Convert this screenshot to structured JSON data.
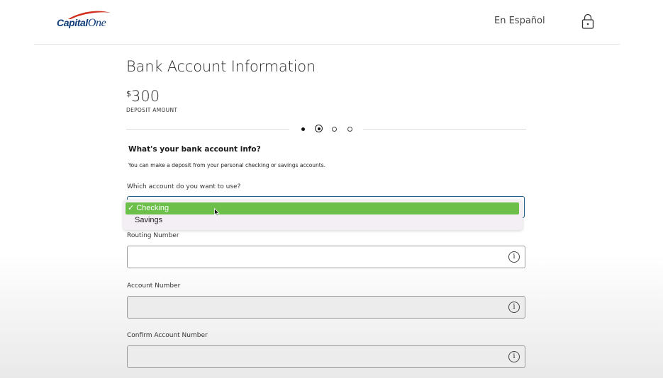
{
  "header": {
    "logo_text": "Capital",
    "logo_text_2": "One",
    "language_link": "En Español",
    "lock_icon": "lock-icon"
  },
  "page": {
    "title": "Bank Account Information",
    "deposit_currency": "$",
    "deposit_amount": "300",
    "deposit_label": "DEPOSIT AMOUNT"
  },
  "stepper": {
    "total_steps": 4,
    "current_step": 2
  },
  "form": {
    "heading": "What's your bank account info?",
    "subheading": "You can make a deposit from your personal checking or savings accounts.",
    "account_type": {
      "label": "Which account do you want to use?",
      "options": [
        "Checking",
        "Savings"
      ],
      "selected": "Checking",
      "check_mark": "✓"
    },
    "routing": {
      "label": "Routing Number",
      "value": ""
    },
    "account_number": {
      "label": "Account Number",
      "value": ""
    },
    "confirm_account_number": {
      "label": "Confirm Account Number",
      "value": ""
    },
    "info_glyph": "i"
  },
  "colors": {
    "brand_navy": "#0c3b78",
    "brand_red": "#d22e1e",
    "selected_option": "#6cc04a",
    "focus_border": "#1f5f8b"
  }
}
